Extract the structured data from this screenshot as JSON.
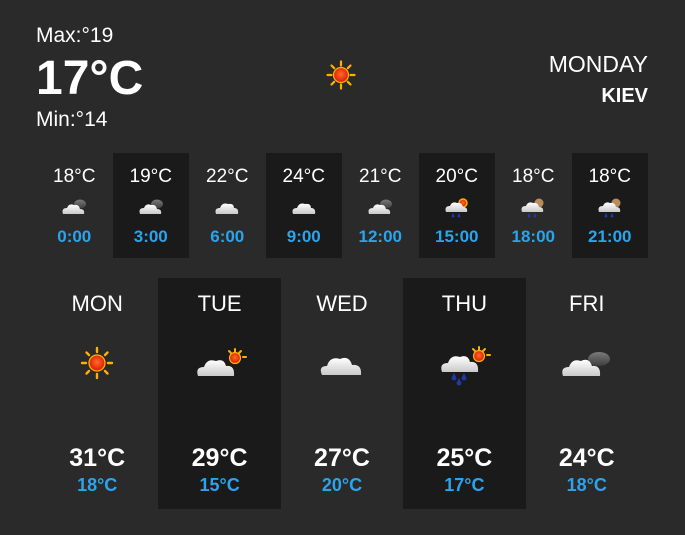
{
  "current": {
    "max": "Max:°19",
    "temp": "17°C",
    "min": "Min:°14",
    "day": "MONDAY",
    "city": "KIEV",
    "icon": "sun-icon"
  },
  "hourly": [
    {
      "temp": "18°C",
      "time": "0:00",
      "icon": "cloud-night-icon"
    },
    {
      "temp": "19°C",
      "time": "3:00",
      "icon": "cloud-night-icon"
    },
    {
      "temp": "22°C",
      "time": "6:00",
      "icon": "cloud-icon"
    },
    {
      "temp": "24°C",
      "time": "9:00",
      "icon": "cloud-icon"
    },
    {
      "temp": "21°C",
      "time": "12:00",
      "icon": "cloud-night-icon"
    },
    {
      "temp": "20°C",
      "time": "15:00",
      "icon": "rain-sun-icon"
    },
    {
      "temp": "18°C",
      "time": "18:00",
      "icon": "rain-moon-icon"
    },
    {
      "temp": "18°C",
      "time": "21:00",
      "icon": "rain-moon-icon"
    }
  ],
  "daily": [
    {
      "name": "MON",
      "high": "31°C",
      "low": "18°C",
      "icon": "sun-icon"
    },
    {
      "name": "TUE",
      "high": "29°C",
      "low": "15°C",
      "icon": "cloud-sun-icon"
    },
    {
      "name": "WED",
      "high": "27°C",
      "low": "20°C",
      "icon": "cloud-icon"
    },
    {
      "name": "THU",
      "high": "25°C",
      "low": "17°C",
      "icon": "rain-sun-icon"
    },
    {
      "name": "FRI",
      "high": "24°C",
      "low": "18°C",
      "icon": "cloud-night-icon"
    }
  ],
  "colors": {
    "background": "#2a2a2a",
    "panel_dark": "#1a1a1a",
    "accent": "#2aa4ec"
  }
}
